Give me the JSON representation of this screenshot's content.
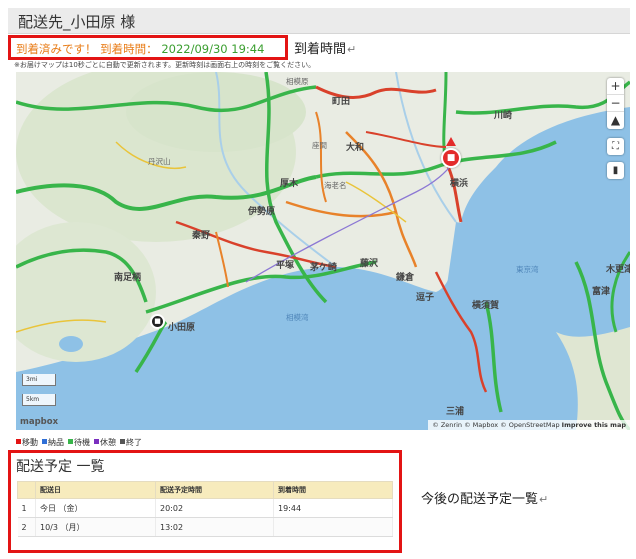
{
  "header": {
    "title": "配送先_小田原 様"
  },
  "arrival": {
    "status": "到着済みです！",
    "time_label": "到着時間：",
    "time_value": "2022/09/30 19:44"
  },
  "annotations": {
    "arrival_callout": "到着時間",
    "schedule_callout": "今後の配送予定一覧",
    "return_mark": "↵"
  },
  "note": "※お届けマップは10秒ごとに自動で更新されます。更新時刻は画面右上の時刻をご覧ください。",
  "map": {
    "labels": {
      "sagamihara": "相模原",
      "machida": "町田",
      "kawasaki": "川崎",
      "zama": "座間",
      "yamato": "大和",
      "atsugi": "厚木",
      "ebina": "海老名",
      "yokohama": "横浜",
      "isehara": "伊勢原",
      "hadano": "秦野",
      "hiratsuka": "平塚",
      "chigasaki": "茅ケ崎",
      "fujisawa": "藤沢",
      "kamakura": "鎌倉",
      "zushi": "逗子",
      "yokosuka": "横須賀",
      "minamiashigara": "南足柄",
      "odawara": "小田原",
      "miura": "三浦",
      "sagami_bay": "相模湾",
      "tokyo_bay": "東京湾",
      "kisarazu": "木更津",
      "futtsu": "富津",
      "tanzawa": "丹沢山"
    },
    "controls": {
      "zoom_in": "+",
      "zoom_out": "−",
      "compass": "▲",
      "fullscreen": "⛶",
      "layers": "▮"
    },
    "scale": {
      "km3": "3mi",
      "km5": "5km"
    },
    "logo": "mapbox",
    "attribution": "© Zenrin © Mapbox © OpenStreetMap",
    "attribution_link": "Improve this map",
    "pin_glyph": "■",
    "dest_glyph": "■"
  },
  "legend": [
    {
      "label": "移動",
      "color": "#e31414"
    },
    {
      "label": "納品",
      "color": "#2f6fd6"
    },
    {
      "label": "待機",
      "color": "#38b54a"
    },
    {
      "label": "休憩",
      "color": "#7a2fbf"
    },
    {
      "label": "終了",
      "color": "#555555"
    }
  ],
  "schedule": {
    "title": "配送予定 一覧",
    "columns": [
      "",
      "配送日",
      "配送予定時間",
      "到着時間"
    ],
    "rows": [
      {
        "no": "1",
        "date": "今日 （金）",
        "planned": "20:02",
        "arrival": "19:44"
      },
      {
        "no": "2",
        "date": "10/3 （月）",
        "planned": "13:02",
        "arrival": ""
      }
    ]
  }
}
